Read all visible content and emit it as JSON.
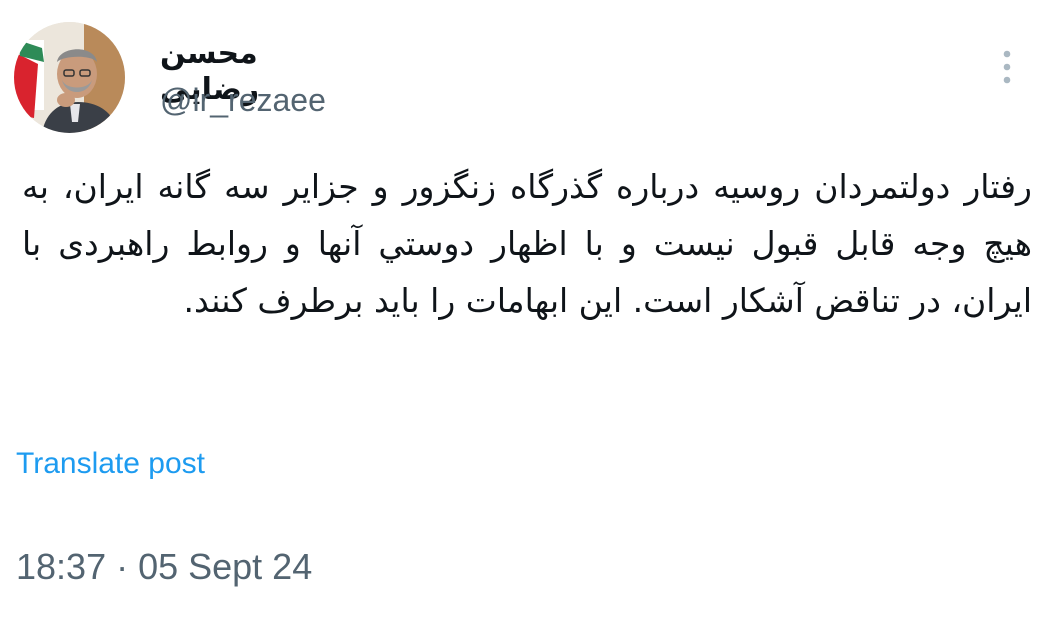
{
  "author": {
    "display_name": "محسن رضایی",
    "handle": "@ir_rezaee",
    "avatar_icon": "profile-photo"
  },
  "tweet": {
    "text": "رفتار دولتمردان روسیه درباره گذرگاه زنگزور و جزایر سه گانه ایران، به هیچ وجه قابل قبول نیست و با اظهار دوستي آنها و روابط راهبردی با ایران، در تناقض آشکار است. این ابهامات را باید برطرف کنند.",
    "translate_label": "Translate post",
    "timestamp": "18:37 · 05 Sept 24"
  },
  "header": {
    "more_icon": "more-vertical-icon"
  },
  "colors": {
    "text_primary": "#0f1419",
    "text_secondary": "#536471",
    "link": "#1d9bf0",
    "icon_muted": "#aab8c2"
  }
}
